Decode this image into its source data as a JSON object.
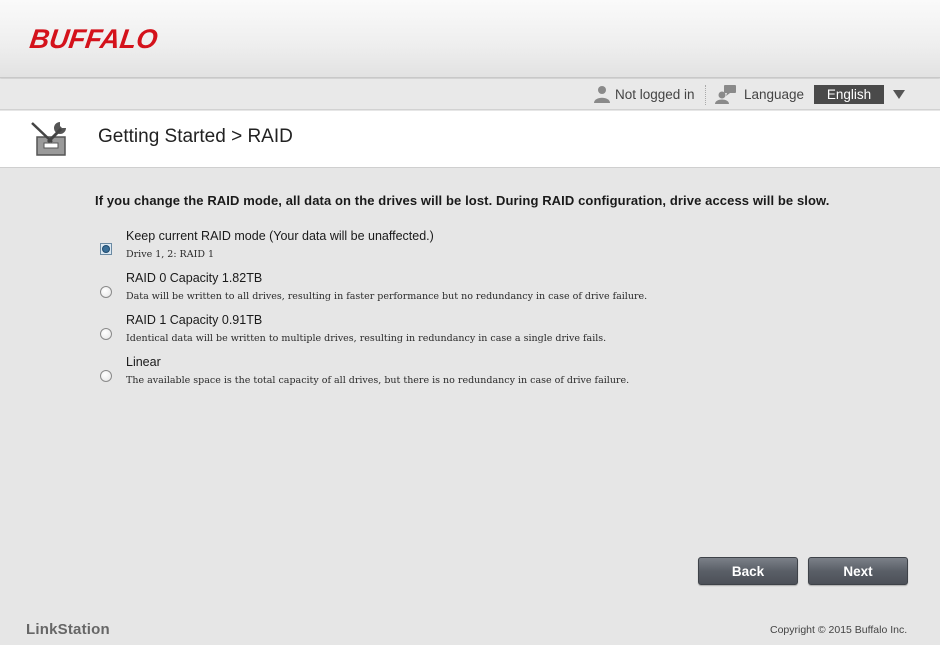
{
  "header": {
    "logo": "BUFFALO"
  },
  "userbar": {
    "login_status": "Not logged in",
    "language_label": "Language",
    "language_value": "English"
  },
  "titlebar": {
    "title": "Getting Started > RAID"
  },
  "main": {
    "warning": "If you change the RAID mode, all data on the drives will be lost.   During RAID configuration, drive access will be slow.",
    "options": [
      {
        "title": "Keep current RAID mode (Your data will be unaffected.)",
        "desc": "Drive 1, 2: RAID 1",
        "checked": true
      },
      {
        "title": "RAID 0 Capacity 1.82TB",
        "desc": "Data will be written to all drives, resulting in faster performance but no redundancy in case of drive failure.",
        "checked": false
      },
      {
        "title": "RAID 1 Capacity 0.91TB",
        "desc": "Identical data will be written to multiple drives, resulting in redundancy in case a single drive fails.",
        "checked": false
      },
      {
        "title": "Linear",
        "desc": "The available space is the total capacity of all drives, but there is no redundancy in case of drive failure.",
        "checked": false
      }
    ]
  },
  "buttons": {
    "back": "Back",
    "next": "Next"
  },
  "footer": {
    "brand": "LinkStation",
    "copyright": "Copyright © 2015 Buffalo Inc."
  },
  "colors": {
    "brand_red": "#d4121b",
    "button_gray": "#5a5f67",
    "language_bg": "#4a4a4a"
  }
}
